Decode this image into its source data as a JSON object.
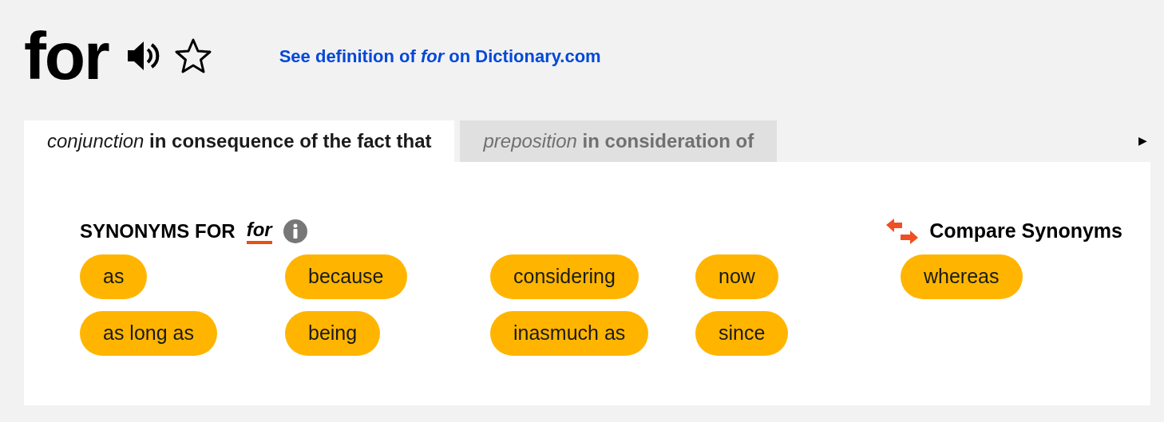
{
  "headword": "for",
  "definition_link": "See definition of *for* on Dictionary.com",
  "tabs": [
    {
      "pos": "conjunction",
      "sense": "in consequence of the fact that",
      "selected": true
    },
    {
      "pos": "preposition",
      "sense": "in consideration of",
      "selected": false
    }
  ],
  "tabs_scroll_arrow": "▶",
  "synonyms_heading": {
    "label": "SYNONYMS FOR",
    "word": "for"
  },
  "compare_button": "Compare Synonyms",
  "synonyms": [
    "as",
    "as long as",
    "because",
    "being",
    "considering",
    "inasmuch as",
    "now",
    "since",
    "whereas"
  ]
}
